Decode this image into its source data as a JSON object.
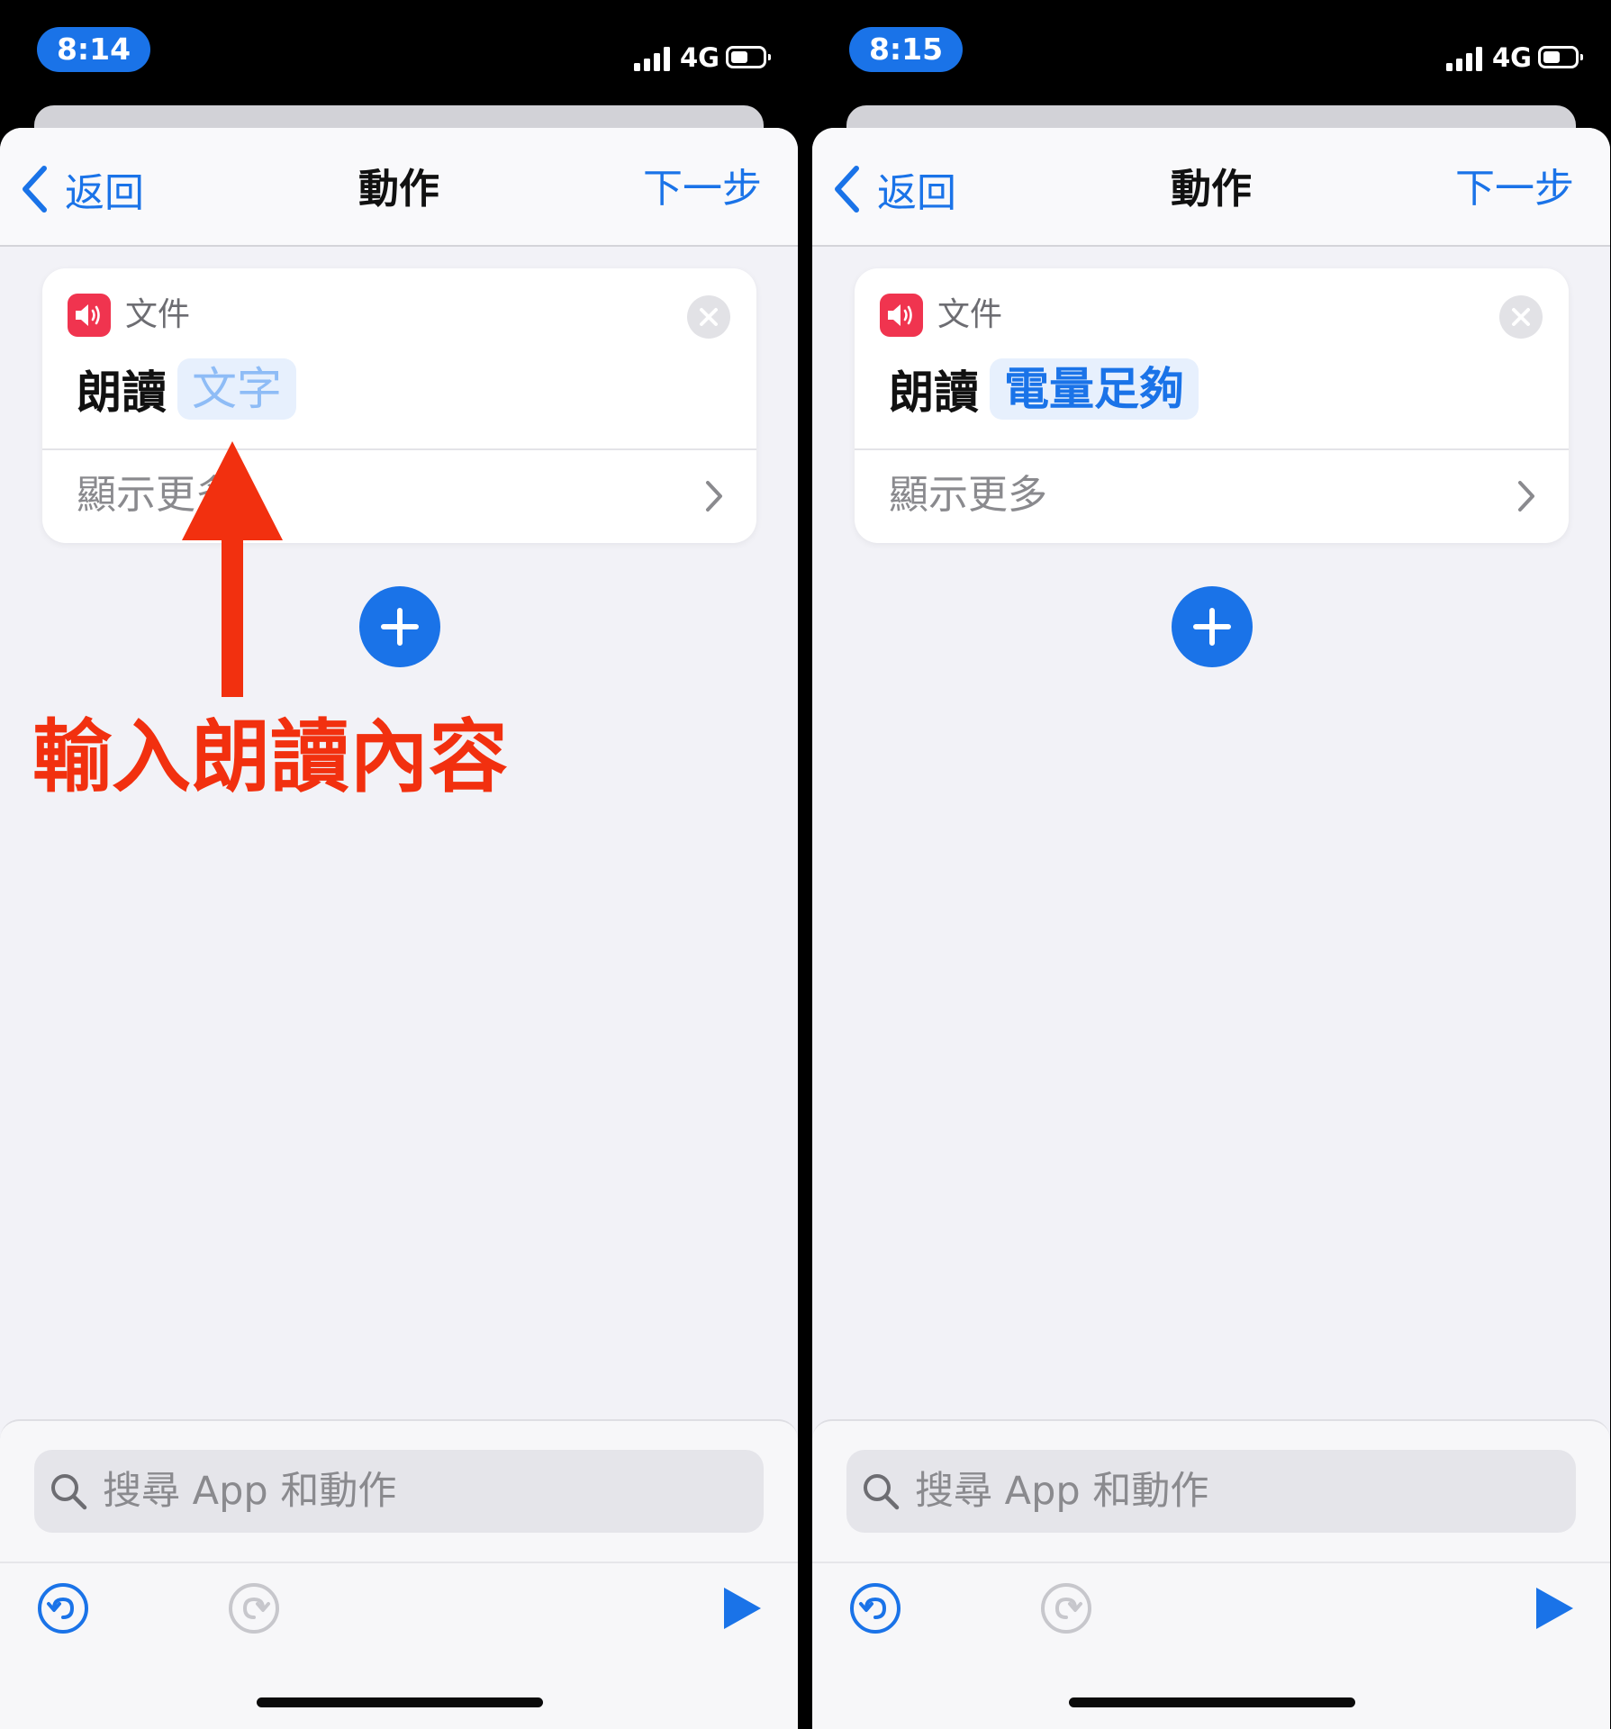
{
  "colors": {
    "accent": "#1a73e8",
    "annotation": "#f2300f",
    "speak_icon_bg": "#f0344f",
    "sheet_bg": "#f2f2f7"
  },
  "screens": [
    {
      "status": {
        "time": "8:14",
        "network": "4G"
      },
      "nav": {
        "back_label": "返回",
        "title": "動作",
        "next_label": "下一步"
      },
      "action_card": {
        "app_name": "文件",
        "app_icon": "speaker-icon",
        "verb": "朗讀",
        "parameter": "文字",
        "parameter_state": "placeholder",
        "show_more_label": "顯示更多"
      },
      "search": {
        "placeholder": "搜尋 App 和動作"
      },
      "toolbar": {
        "undo_icon": "undo-icon",
        "redo_icon": "redo-icon",
        "play_icon": "play-icon"
      }
    },
    {
      "status": {
        "time": "8:15",
        "network": "4G"
      },
      "nav": {
        "back_label": "返回",
        "title": "動作",
        "next_label": "下一步"
      },
      "action_card": {
        "app_name": "文件",
        "app_icon": "speaker-icon",
        "verb": "朗讀",
        "parameter": "電量足夠",
        "parameter_state": "filled",
        "show_more_label": "顯示更多"
      },
      "search": {
        "placeholder": "搜尋 App 和動作"
      },
      "toolbar": {
        "undo_icon": "undo-icon",
        "redo_icon": "redo-icon",
        "play_icon": "play-icon"
      }
    }
  ],
  "annotation": {
    "text": "輸入朗讀內容",
    "arrow_icon": "arrow-up-icon"
  }
}
